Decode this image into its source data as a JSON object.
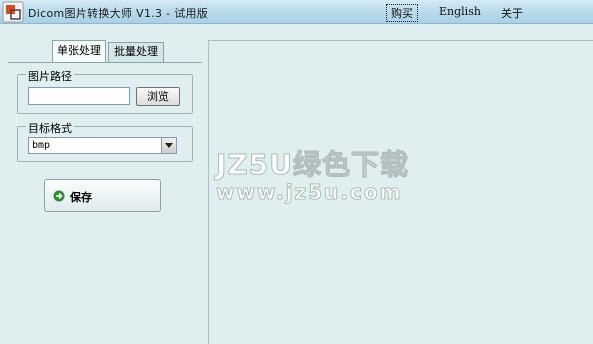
{
  "window": {
    "title": "Dicom图片转换大师 V1.3 - 试用版",
    "icon": "app-logo-icon"
  },
  "menu": {
    "buy": "购买",
    "english": "English",
    "about": "关于"
  },
  "tabs": {
    "single": "单张处理",
    "batch": "批量处理"
  },
  "image_path": {
    "legend": "图片路径",
    "value": "",
    "browse_label": "浏览"
  },
  "target_format": {
    "legend": "目标格式",
    "selected": "bmp"
  },
  "save": {
    "label": "保存",
    "icon": "green-arrow-icon"
  },
  "watermark": {
    "line1": "JZ5U绿色下载",
    "line2": "www.jz5u.com"
  },
  "colors": {
    "background": "#dfeeee",
    "titlebar": "#bcdcec",
    "save_icon": "#2e8b2e"
  }
}
